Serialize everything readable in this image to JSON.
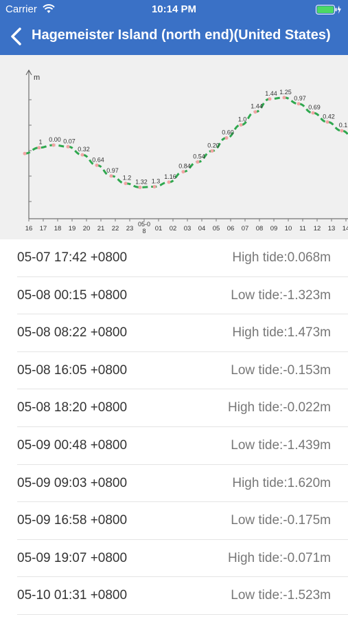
{
  "status_bar": {
    "carrier": "Carrier",
    "time": "10:14 PM"
  },
  "nav": {
    "title": "Hagemeister Island (north end)(United States)"
  },
  "colors": {
    "header": "#3a71c6",
    "curve": "#2fa84f",
    "point": "#f1a3a3"
  },
  "chart_data": {
    "type": "line",
    "ylabel": "m",
    "x_ticks": [
      "16",
      "17",
      "18",
      "19",
      "20",
      "21",
      "22",
      "23",
      "05-0\n8",
      "01",
      "02",
      "03",
      "04",
      "05",
      "06",
      "07",
      "08",
      "09",
      "10",
      "11",
      "12",
      "13",
      "14"
    ],
    "series": [
      {
        "x": [
          0,
          1,
          2,
          3,
          4,
          5,
          6,
          7,
          8,
          9,
          10,
          11,
          12,
          13,
          14,
          15,
          16,
          17,
          18,
          19,
          20,
          21,
          22,
          23
        ],
        "y": [
          -0.28,
          -0.1,
          -0.02,
          -0.07,
          -0.32,
          -0.64,
          -0.97,
          -1.2,
          -1.32,
          -1.3,
          -1.16,
          -0.84,
          -0.54,
          -0.2,
          0.2,
          0.6,
          1.0,
          1.4,
          1.44,
          1.25,
          0.97,
          0.69,
          0.42,
          0.1
        ]
      }
    ],
    "data_labels": [
      "",
      "1",
      "0.00",
      "0.07",
      "0.32",
      "0.64",
      "0.97",
      "1.2",
      "1.32",
      "1.3",
      "1.16",
      "0.84",
      "0.54",
      "0.20",
      "0.60",
      "1.0",
      "1.44",
      "1.44",
      "1.25",
      "0.97",
      "0.69",
      "0.42",
      "0.1",
      ""
    ],
    "ylim": [
      -2.2,
      2.2
    ]
  },
  "tides": [
    {
      "time": "05-07 17:42 +0800",
      "type": "High tide:0.068m"
    },
    {
      "time": "05-08 00:15 +0800",
      "type": "Low tide:-1.323m"
    },
    {
      "time": "05-08 08:22 +0800",
      "type": "High tide:1.473m"
    },
    {
      "time": "05-08 16:05 +0800",
      "type": "Low tide:-0.153m"
    },
    {
      "time": "05-08 18:20 +0800",
      "type": "High tide:-0.022m"
    },
    {
      "time": "05-09 00:48 +0800",
      "type": "Low tide:-1.439m"
    },
    {
      "time": "05-09 09:03 +0800",
      "type": "High tide:1.620m"
    },
    {
      "time": "05-09 16:58 +0800",
      "type": "Low tide:-0.175m"
    },
    {
      "time": "05-09 19:07 +0800",
      "type": "High tide:-0.071m"
    },
    {
      "time": "05-10 01:31 +0800",
      "type": "Low tide:-1.523m"
    }
  ]
}
